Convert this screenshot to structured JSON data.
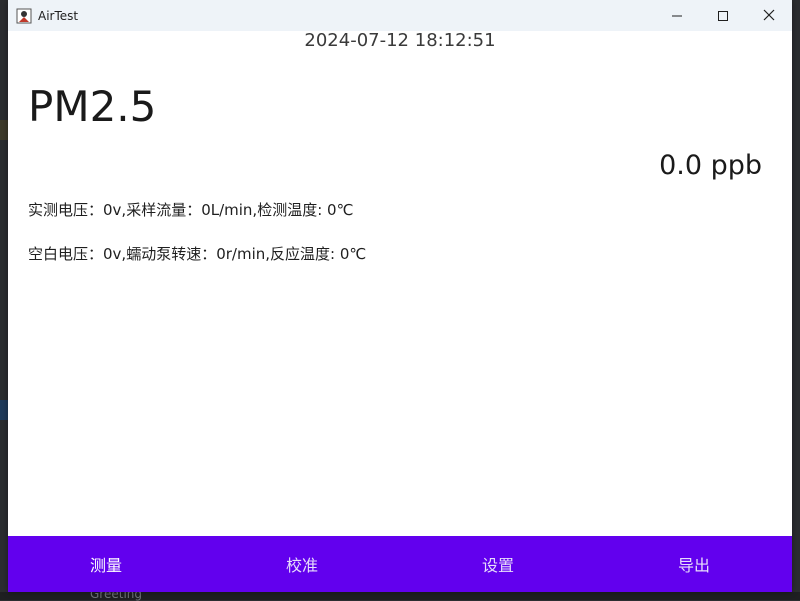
{
  "window": {
    "title": "AirTest",
    "icons": {
      "app": "app-icon",
      "minimize": "minimize-icon",
      "maximize": "maximize-icon",
      "close": "close-icon"
    }
  },
  "header": {
    "datetime": "2024-07-12 18:12:51"
  },
  "measurement": {
    "name": "PM2.5",
    "value": "0.0 ppb",
    "line1": "实测电压：0v,采样流量：0L/min,检测温度: 0℃",
    "line2": "空白电压：0v,蠕动泵转速：0r/min,反应温度: 0℃"
  },
  "nav": {
    "items": [
      {
        "label": "测量",
        "active": true
      },
      {
        "label": "校准",
        "active": false
      },
      {
        "label": "设置",
        "active": false
      },
      {
        "label": "导出",
        "active": false
      }
    ]
  },
  "background": {
    "bottom_text": "Greeting"
  },
  "colors": {
    "nav_bg": "#6200ee",
    "titlebar_bg": "#eef3f8",
    "content_bg": "#ffffff"
  }
}
